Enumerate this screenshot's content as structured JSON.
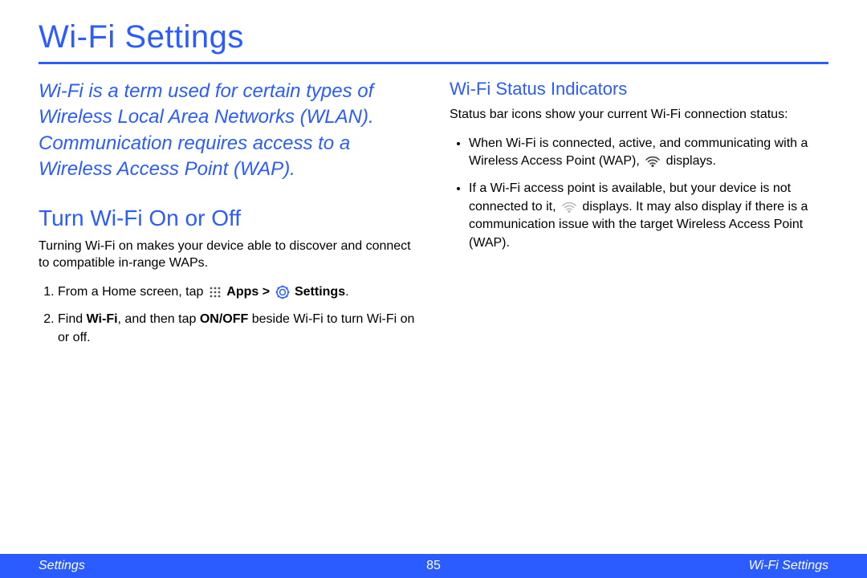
{
  "title": "Wi-Fi Settings",
  "intro": "Wi-Fi is a term used for certain types of Wireless Local Area Networks (WLAN). Communication requires access to a Wireless Access Point (WAP).",
  "section_turn": {
    "heading": "Turn Wi-Fi On or Off",
    "body": "Turning Wi-Fi on makes your device able to discover and connect to compatible in-range WAPs.",
    "step1_a": "From a Home screen, tap ",
    "step1_apps": "Apps",
    "step1_gt": " > ",
    "step1_settings": "Settings",
    "step1_dot": ".",
    "step2_a": "Find ",
    "step2_wifi": "Wi-Fi",
    "step2_b": ", and then tap ",
    "step2_onoff": "ON/OFF",
    "step2_c": " beside Wi-Fi to turn Wi-Fi on or off."
  },
  "section_status": {
    "heading": "Wi-Fi Status Indicators",
    "body": "Status bar icons show your current Wi-Fi connection status:",
    "b1_a": "When Wi-Fi is connected, active, and communicating with a Wireless Access Point (WAP), ",
    "b1_b": " displays.",
    "b2_a": "If a Wi-Fi access point is available, but your device is not connected to it, ",
    "b2_b": " displays. It may also display if there is a communication issue with the target Wireless Access Point (WAP)."
  },
  "footer": {
    "left": "Settings",
    "center": "85",
    "right": "Wi-Fi Settings"
  }
}
